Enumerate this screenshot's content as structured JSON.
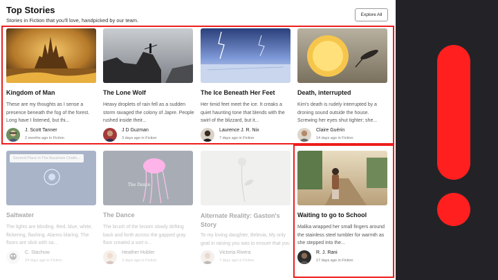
{
  "header": {
    "title": "Top Stories",
    "subtitle": "Stories in Fiction that you'll love, handpicked by our team.",
    "explore_label": "Explore All"
  },
  "stories": [
    {
      "title": "Kingdom of Man",
      "excerpt": "These are my thoughts as I sense a presence beneath the fog of the forest. Long have I listened, but thi...",
      "author": "J. Scott Tanner",
      "meta": "2 months ago in Fiction",
      "badge": ""
    },
    {
      "title": "The Lone Wolf",
      "excerpt": "Heavy droplets of rain fell as a sudden storm ravaged the colony of Japre. People rushed inside their...",
      "author": "J D Guzman",
      "meta": "3 days ago in Fiction",
      "badge": ""
    },
    {
      "title": "The Ice Beneath Her Feet",
      "excerpt": "Her timid feet meet the ice. It creaks a quiet haunting tone that blends with the swirl of the blizzard, but it...",
      "author": "Laurence J. R. Nix",
      "meta": "7 days ago in Fiction",
      "badge": ""
    },
    {
      "title": "Death, interrupted",
      "excerpt": "Kim's death is rudely interrupted by a droning sound outside the house. Screwing her eyes shut tighter; she...",
      "author": "Claire Guérin",
      "meta": "14 days ago in Fiction",
      "badge": ""
    },
    {
      "title": "Saltwater",
      "excerpt": "The lights are blinding. Red, blue, white, flickering, flashing. Alarms blaring. The floors are slick with sa...",
      "author": "C. Stachow",
      "meta": "24 days ago in Fiction",
      "badge": "Second Place in The Aquarium Challe..."
    },
    {
      "title": "The Dance",
      "excerpt": "The brush of the broom slowly drifting back and forth across the gapped gray floor created a sort o...",
      "author": "Heather Hubler",
      "meta": "3 days ago in Fiction",
      "badge": ""
    },
    {
      "title": "Alternate Reality: Gaston's Story",
      "excerpt": "To my loving daughter, Belevia,  My only goal in raising you was to ensure that you did not grow up...",
      "author": "Victoria Rivera",
      "meta": "7 days ago in Fiction",
      "badge": ""
    },
    {
      "title": "Waiting to go to School",
      "excerpt": "Malika wrapped her small fingers around the stainless steel tumbler for warmth as she stepped into the...",
      "author": "R. J. Rani",
      "meta": "17 days ago in Fiction",
      "badge": ""
    }
  ],
  "dance_image_caption": "The Dance",
  "colors": {
    "highlight": "#ee1c1c",
    "alert_panel": "#232327",
    "alert_mark": "#ff1f1f"
  },
  "icons": {
    "alert": "exclamation-mark-icon"
  }
}
